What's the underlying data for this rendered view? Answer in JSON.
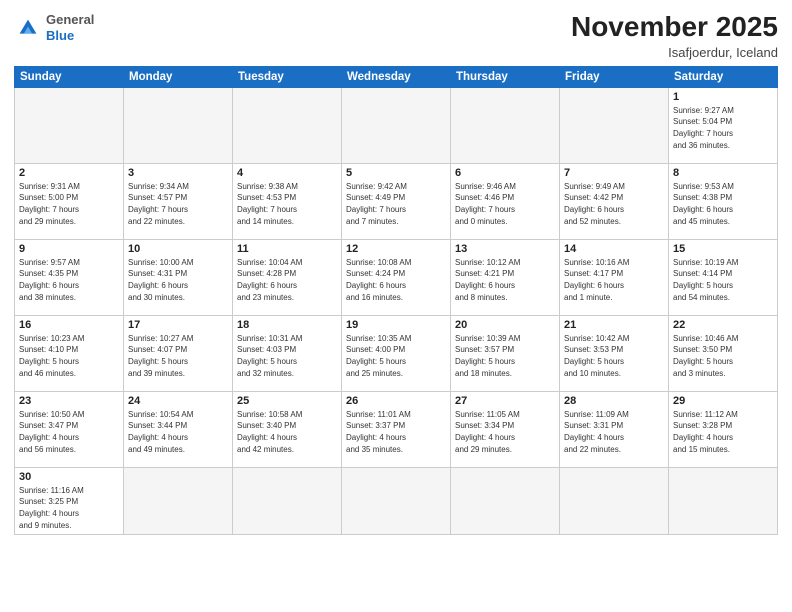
{
  "logo": {
    "general": "General",
    "blue": "Blue"
  },
  "header": {
    "month": "November 2025",
    "location": "Isafjoerdur, Iceland"
  },
  "weekdays": [
    "Sunday",
    "Monday",
    "Tuesday",
    "Wednesday",
    "Thursday",
    "Friday",
    "Saturday"
  ],
  "weeks": [
    [
      {
        "day": "",
        "info": ""
      },
      {
        "day": "",
        "info": ""
      },
      {
        "day": "",
        "info": ""
      },
      {
        "day": "",
        "info": ""
      },
      {
        "day": "",
        "info": ""
      },
      {
        "day": "",
        "info": ""
      },
      {
        "day": "1",
        "info": "Sunrise: 9:27 AM\nSunset: 5:04 PM\nDaylight: 7 hours\nand 36 minutes."
      }
    ],
    [
      {
        "day": "2",
        "info": "Sunrise: 9:31 AM\nSunset: 5:00 PM\nDaylight: 7 hours\nand 29 minutes."
      },
      {
        "day": "3",
        "info": "Sunrise: 9:34 AM\nSunset: 4:57 PM\nDaylight: 7 hours\nand 22 minutes."
      },
      {
        "day": "4",
        "info": "Sunrise: 9:38 AM\nSunset: 4:53 PM\nDaylight: 7 hours\nand 14 minutes."
      },
      {
        "day": "5",
        "info": "Sunrise: 9:42 AM\nSunset: 4:49 PM\nDaylight: 7 hours\nand 7 minutes."
      },
      {
        "day": "6",
        "info": "Sunrise: 9:46 AM\nSunset: 4:46 PM\nDaylight: 7 hours\nand 0 minutes."
      },
      {
        "day": "7",
        "info": "Sunrise: 9:49 AM\nSunset: 4:42 PM\nDaylight: 6 hours\nand 52 minutes."
      },
      {
        "day": "8",
        "info": "Sunrise: 9:53 AM\nSunset: 4:38 PM\nDaylight: 6 hours\nand 45 minutes."
      }
    ],
    [
      {
        "day": "9",
        "info": "Sunrise: 9:57 AM\nSunset: 4:35 PM\nDaylight: 6 hours\nand 38 minutes."
      },
      {
        "day": "10",
        "info": "Sunrise: 10:00 AM\nSunset: 4:31 PM\nDaylight: 6 hours\nand 30 minutes."
      },
      {
        "day": "11",
        "info": "Sunrise: 10:04 AM\nSunset: 4:28 PM\nDaylight: 6 hours\nand 23 minutes."
      },
      {
        "day": "12",
        "info": "Sunrise: 10:08 AM\nSunset: 4:24 PM\nDaylight: 6 hours\nand 16 minutes."
      },
      {
        "day": "13",
        "info": "Sunrise: 10:12 AM\nSunset: 4:21 PM\nDaylight: 6 hours\nand 8 minutes."
      },
      {
        "day": "14",
        "info": "Sunrise: 10:16 AM\nSunset: 4:17 PM\nDaylight: 6 hours\nand 1 minute."
      },
      {
        "day": "15",
        "info": "Sunrise: 10:19 AM\nSunset: 4:14 PM\nDaylight: 5 hours\nand 54 minutes."
      }
    ],
    [
      {
        "day": "16",
        "info": "Sunrise: 10:23 AM\nSunset: 4:10 PM\nDaylight: 5 hours\nand 46 minutes."
      },
      {
        "day": "17",
        "info": "Sunrise: 10:27 AM\nSunset: 4:07 PM\nDaylight: 5 hours\nand 39 minutes."
      },
      {
        "day": "18",
        "info": "Sunrise: 10:31 AM\nSunset: 4:03 PM\nDaylight: 5 hours\nand 32 minutes."
      },
      {
        "day": "19",
        "info": "Sunrise: 10:35 AM\nSunset: 4:00 PM\nDaylight: 5 hours\nand 25 minutes."
      },
      {
        "day": "20",
        "info": "Sunrise: 10:39 AM\nSunset: 3:57 PM\nDaylight: 5 hours\nand 18 minutes."
      },
      {
        "day": "21",
        "info": "Sunrise: 10:42 AM\nSunset: 3:53 PM\nDaylight: 5 hours\nand 10 minutes."
      },
      {
        "day": "22",
        "info": "Sunrise: 10:46 AM\nSunset: 3:50 PM\nDaylight: 5 hours\nand 3 minutes."
      }
    ],
    [
      {
        "day": "23",
        "info": "Sunrise: 10:50 AM\nSunset: 3:47 PM\nDaylight: 4 hours\nand 56 minutes."
      },
      {
        "day": "24",
        "info": "Sunrise: 10:54 AM\nSunset: 3:44 PM\nDaylight: 4 hours\nand 49 minutes."
      },
      {
        "day": "25",
        "info": "Sunrise: 10:58 AM\nSunset: 3:40 PM\nDaylight: 4 hours\nand 42 minutes."
      },
      {
        "day": "26",
        "info": "Sunrise: 11:01 AM\nSunset: 3:37 PM\nDaylight: 4 hours\nand 35 minutes."
      },
      {
        "day": "27",
        "info": "Sunrise: 11:05 AM\nSunset: 3:34 PM\nDaylight: 4 hours\nand 29 minutes."
      },
      {
        "day": "28",
        "info": "Sunrise: 11:09 AM\nSunset: 3:31 PM\nDaylight: 4 hours\nand 22 minutes."
      },
      {
        "day": "29",
        "info": "Sunrise: 11:12 AM\nSunset: 3:28 PM\nDaylight: 4 hours\nand 15 minutes."
      }
    ],
    [
      {
        "day": "30",
        "info": "Sunrise: 11:16 AM\nSunset: 3:25 PM\nDaylight: 4 hours\nand 9 minutes."
      },
      {
        "day": "",
        "info": ""
      },
      {
        "day": "",
        "info": ""
      },
      {
        "day": "",
        "info": ""
      },
      {
        "day": "",
        "info": ""
      },
      {
        "day": "",
        "info": ""
      },
      {
        "day": "",
        "info": ""
      }
    ]
  ]
}
